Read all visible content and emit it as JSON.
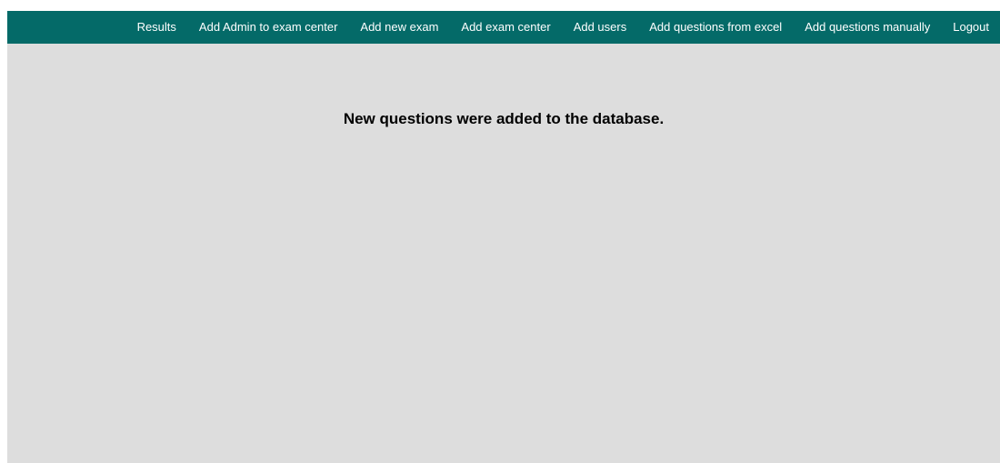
{
  "nav": {
    "items": [
      {
        "label": "Results"
      },
      {
        "label": "Add Admin to exam center"
      },
      {
        "label": "Add new exam"
      },
      {
        "label": "Add exam center"
      },
      {
        "label": "Add users"
      },
      {
        "label": "Add questions from excel"
      },
      {
        "label": "Add questions manually"
      },
      {
        "label": "Logout"
      }
    ]
  },
  "main": {
    "message": "New questions were added to the database."
  },
  "colors": {
    "navbar_bg": "#046a68",
    "page_bg": "#dddddd",
    "nav_text": "#ffffff"
  }
}
